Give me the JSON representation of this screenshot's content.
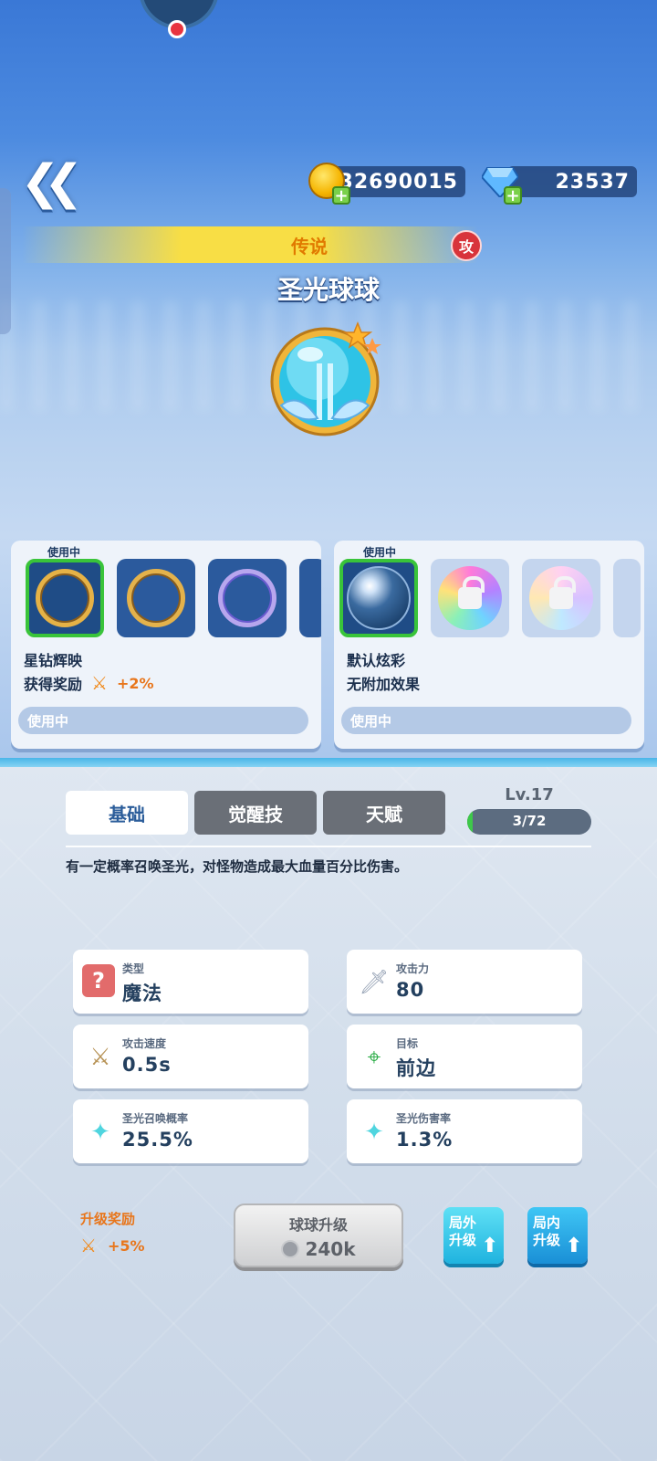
{
  "currency": {
    "gold": "32690015",
    "gems": "23537"
  },
  "ball": {
    "rarity": "传说",
    "attack_badge": "攻",
    "name": "圣光球球"
  },
  "skin_panel_left": {
    "in_use_tag": "使用中",
    "selected_name": "星钻辉映",
    "reward_label": "获得奖励",
    "reward_value": "+2%",
    "status_bar": "使用中"
  },
  "skin_panel_right": {
    "in_use_tag": "使用中",
    "selected_name": "默认炫彩",
    "effect": "无附加效果",
    "status_bar": "使用中"
  },
  "tabs": [
    {
      "label": "基础",
      "active": true
    },
    {
      "label": "觉醒技",
      "active": false
    },
    {
      "label": "天赋",
      "active": false
    }
  ],
  "level": {
    "label": "Lv.17",
    "progress_text": "3/72",
    "progress_fraction": 0.042
  },
  "description": "有一定概率召唤圣光，对怪物造成最大血量百分比伤害。",
  "stats": [
    {
      "label": "类型",
      "value": "魔法",
      "icon": "question-icon"
    },
    {
      "label": "攻击力",
      "value": "80",
      "icon": "sword-icon"
    },
    {
      "label": "攻击速度",
      "value": "0.5s",
      "icon": "crossed-swords-icon"
    },
    {
      "label": "目标",
      "value": "前边",
      "icon": "target-icon"
    },
    {
      "label": "圣光召唤概率",
      "value": "25.5%",
      "icon": "holy-light-icon"
    },
    {
      "label": "圣光伤害率",
      "value": "1.3%",
      "icon": "holy-light-damage-icon"
    }
  ],
  "upgrade_reward": {
    "title": "升级奖励",
    "value": "+5%"
  },
  "upgrade_button": {
    "label": "球球升级",
    "cost": "240k"
  },
  "outside_upgrade": "局外\n升级",
  "inside_upgrade": "局内\n升级",
  "outside_upgrade_l1": "局外",
  "outside_upgrade_l2": "升级",
  "inside_upgrade_l1": "局内",
  "inside_upgrade_l2": "升级"
}
